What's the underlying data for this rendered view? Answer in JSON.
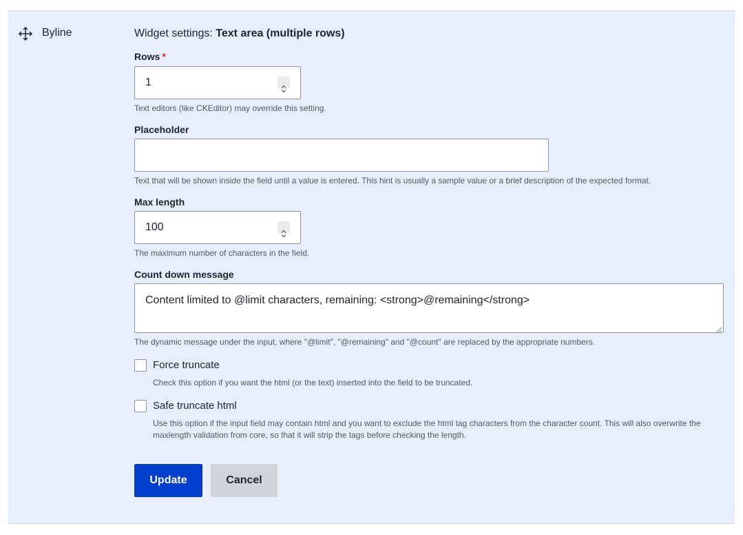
{
  "field": {
    "name": "Byline",
    "drag_icon": "move-arrows-icon"
  },
  "widget": {
    "heading_prefix": "Widget settings: ",
    "heading_type": "Text area (multiple rows)"
  },
  "rows": {
    "label": "Rows",
    "required_marker": "*",
    "value": "1",
    "description": "Text editors (like CKEditor) may override this setting."
  },
  "placeholder": {
    "label": "Placeholder",
    "value": "",
    "description": "Text that will be shown inside the field until a value is entered. This hint is usually a sample value or a brief description of the expected format."
  },
  "max_length": {
    "label": "Max length",
    "value": "100",
    "description": "The maximum number of characters in the field."
  },
  "countdown": {
    "label": "Count down message",
    "value": "Content limited to @limit characters, remaining: <strong>@remaining</strong>",
    "description": "The dynamic message under the input, where \"@limit\", \"@remaining\" and \"@count\" are replaced by the appropriate numbers."
  },
  "force_truncate": {
    "label": "Force truncate",
    "checked": false,
    "description": "Check this option if you want the html (or the text) inserted into the field to be truncated."
  },
  "safe_truncate": {
    "label": "Safe truncate html",
    "checked": false,
    "description": "Use this option if the input field may contain html and you want to exclude the html tag characters from the character count. This will also overwrite the maxlength validation from core, so that it will strip the tags before checking the length."
  },
  "actions": {
    "update_label": "Update",
    "cancel_label": "Cancel"
  },
  "colors": {
    "panel_bg": "#e8eefb",
    "primary": "#003ecc",
    "secondary": "#d3d4d9",
    "required": "#dc2323"
  }
}
